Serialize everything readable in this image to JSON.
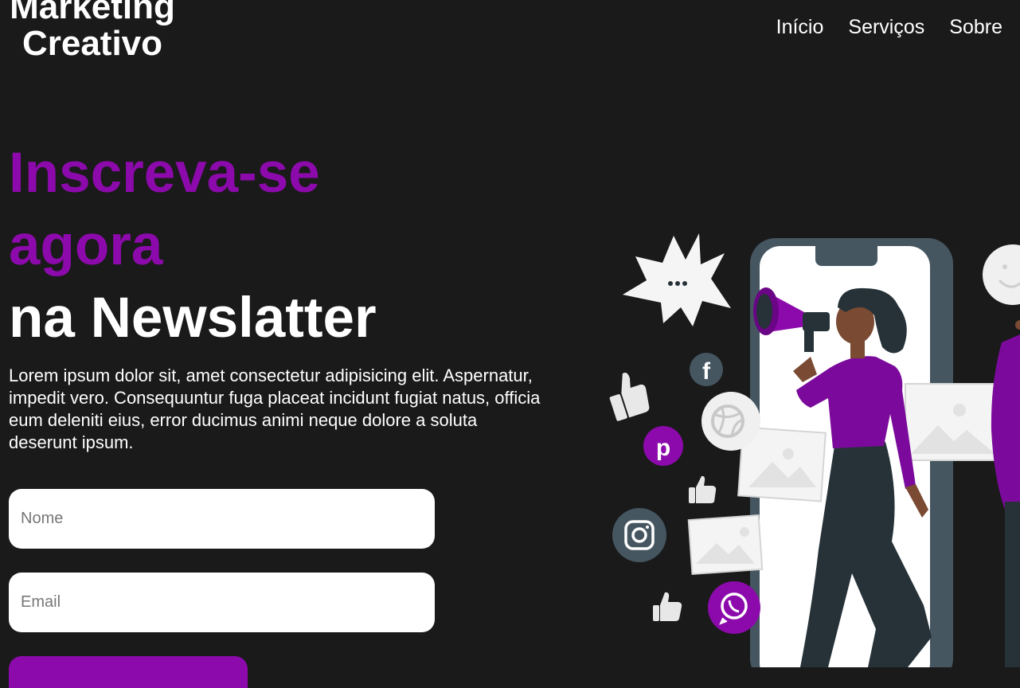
{
  "header": {
    "logo_line1": "Marketing",
    "logo_line2": "Creativo",
    "nav": [
      {
        "label": "Início"
      },
      {
        "label": "Serviços"
      },
      {
        "label": "Sobre"
      }
    ]
  },
  "hero": {
    "title_accent_line1": "Inscreva-se",
    "title_accent_line2": "agora",
    "title_white": "na Newslatter",
    "description": "Lorem ipsum dolor sit, amet consectetur adipisicing elit. Aspernatur, impedit vero. Consequuntur fuga placeat incidunt fugiat natus, officia eum deleniti eius, error ducimus animi neque dolore a soluta deserunt ipsum."
  },
  "form": {
    "name_placeholder": "Nome",
    "email_placeholder": "Email",
    "submit_label": ""
  },
  "illustration": {
    "icons": [
      "facebook-icon",
      "dribbble-icon",
      "pinterest-icon",
      "instagram-icon",
      "whatsapp-icon",
      "thumbs-up-icon",
      "image-placeholder-icon",
      "speech-burst-icon"
    ],
    "colors": {
      "accent": "#8c0aab",
      "background": "#1a1a1a",
      "phone_frame": "#455661",
      "skin": "#7a4a32",
      "pants": "#263238"
    }
  }
}
